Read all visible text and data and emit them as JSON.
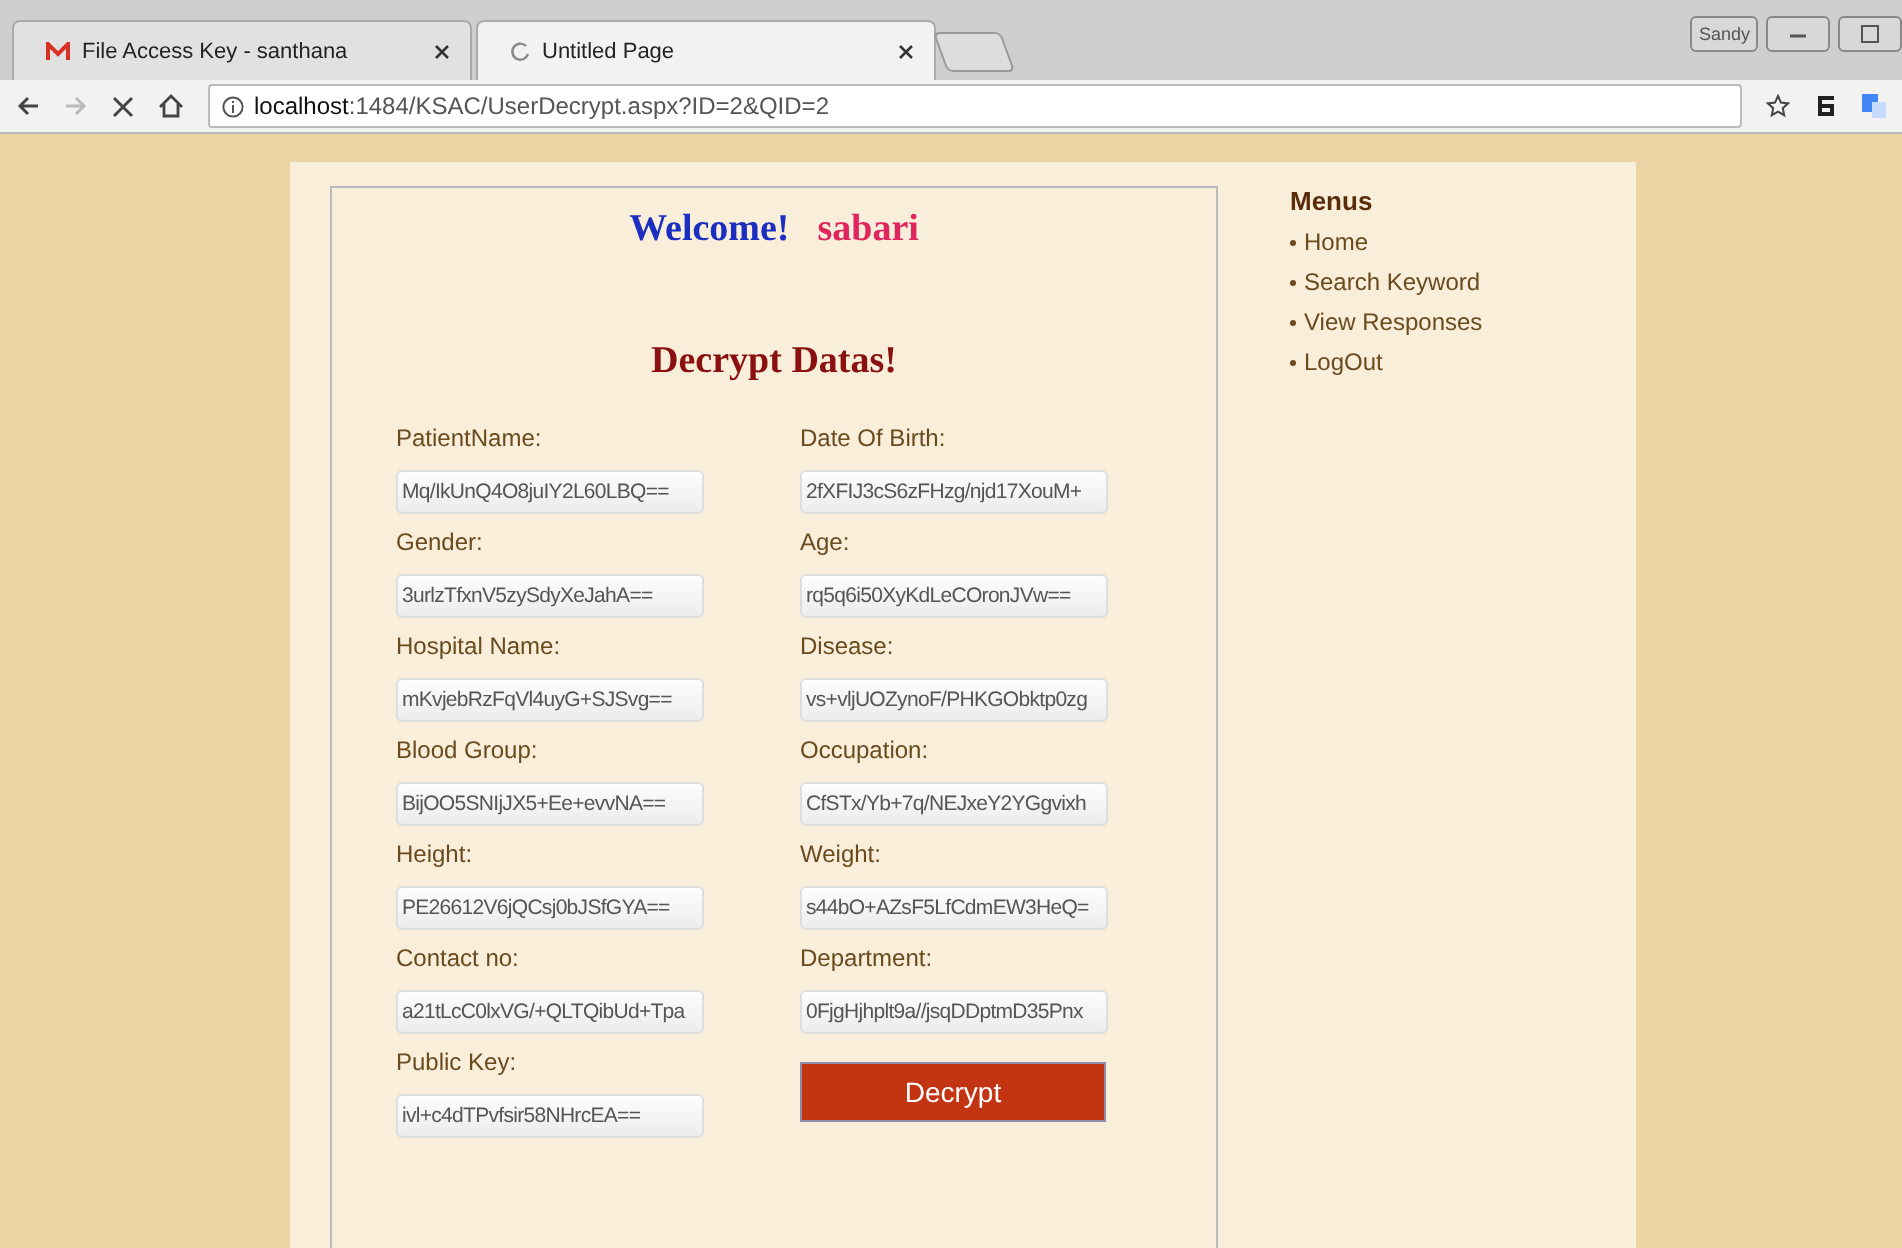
{
  "browser": {
    "tabs": [
      {
        "title": "File Access Key - santhana",
        "selected": false,
        "kind": "mail"
      },
      {
        "title": "Untitled Page",
        "selected": true,
        "kind": "loading"
      }
    ],
    "profile": "Sandy",
    "address": "**localhost**:1484/KSAC/UserDecrypt.aspx?ID=2&QID=2"
  },
  "welcome": {
    "greeting": "Welcome!",
    "user": "sabari"
  },
  "form": {
    "title": "Decrypt Datas!",
    "fields": [
      {
        "label": "PatientName:",
        "value": "Mq/IkUnQ4O8juIY2L60LBQ=="
      },
      {
        "label": "Date Of Birth:",
        "value": "2fXFIJ3cS6zFHzg/njd17XouM+"
      },
      {
        "label": "Gender:",
        "value": "3urlzTfxnV5zySdyXeJahA=="
      },
      {
        "label": "Age:",
        "value": "rq5q6i50XyKdLeCOronJVw=="
      },
      {
        "label": "Hospital Name:",
        "value": "mKvjebRzFqVl4uyG+SJSvg=="
      },
      {
        "label": "Disease:",
        "value": "vs+vljUOZynoF/PHKGObktp0zg"
      },
      {
        "label": "Blood Group:",
        "value": "BijOO5SNIjJX5+Ee+evvNA=="
      },
      {
        "label": "Occupation:",
        "value": "CfSTx/Yb+7q/NEJxeY2YGgvixh"
      },
      {
        "label": "Height:",
        "value": "PE26612V6jQCsj0bJSfGYA=="
      },
      {
        "label": "Weight:",
        "value": "s44bO+AZsF5LfCdmEW3HeQ="
      },
      {
        "label": "Contact no:",
        "value": "a21tLcC0lxVG/+QLTQibUd+Tpa"
      },
      {
        "label": "Department:",
        "value": "0FjgHjhplt9a//jsqDDptmD35Pnx"
      },
      {
        "label": "Public Key:",
        "value": "ivl+c4dTPvfsir58NHrcEA=="
      }
    ],
    "button": "Decrypt"
  },
  "menu": {
    "title": "Menus",
    "items": [
      "Home",
      "Search Keyword",
      "View Responses",
      "LogOut"
    ]
  }
}
